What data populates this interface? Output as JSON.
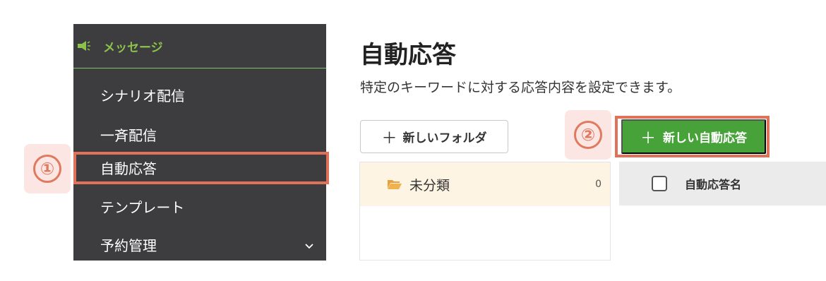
{
  "sidebar": {
    "header_label": "メッセージ",
    "header_icon": "megaphone-icon",
    "accent_color": "#8bc34a",
    "items": [
      {
        "label": "シナリオ配信"
      },
      {
        "label": "一斉配信"
      },
      {
        "label": "自動応答"
      },
      {
        "label": "テンプレート"
      },
      {
        "label": "予約管理",
        "icon": "chevron-down-icon"
      }
    ]
  },
  "callouts": {
    "one": "①",
    "two": "②",
    "highlight_color": "#e0725a"
  },
  "main": {
    "title": "自動応答",
    "description": "特定のキーワードに対する応答内容を設定できます。",
    "new_folder_label": "新しいフォルダ",
    "new_response_label": "新しい自動応答",
    "button_color": "#48a23a",
    "folders": [
      {
        "name": "未分類",
        "count": "0",
        "icon": "folder-open-icon"
      }
    ],
    "list_header": {
      "name_column": "自動応答名"
    }
  }
}
